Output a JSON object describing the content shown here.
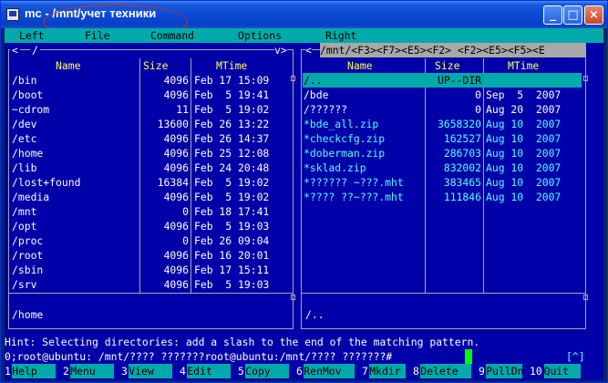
{
  "window": {
    "title": "mc - /mnt/учет техники",
    "controls": {
      "minimize": "_",
      "maximize": "□",
      "close": "×"
    }
  },
  "menu": [
    "Left",
    "File",
    "Command",
    "Options",
    "Right"
  ],
  "left_panel": {
    "path": "/",
    "corner_right": "v>",
    "corner_left": "<",
    "columns": [
      "Name",
      "Size",
      "MTime"
    ],
    "rows": [
      {
        "name": "/bin",
        "size": "4096",
        "date": "Feb 17 15:09"
      },
      {
        "name": "/boot",
        "size": "4096",
        "date": "Feb  5 19:41"
      },
      {
        "name": "~cdrom",
        "size": "11",
        "date": "Feb  5 19:02"
      },
      {
        "name": "/dev",
        "size": "13600",
        "date": "Feb 26 13:22"
      },
      {
        "name": "/etc",
        "size": "4096",
        "date": "Feb 26 14:37"
      },
      {
        "name": "/home",
        "size": "4096",
        "date": "Feb 25 12:08"
      },
      {
        "name": "/lib",
        "size": "4096",
        "date": "Feb 24 20:48"
      },
      {
        "name": "/lost+found",
        "size": "16384",
        "date": "Feb  5 19:02"
      },
      {
        "name": "/media",
        "size": "4096",
        "date": "Feb  5 19:02"
      },
      {
        "name": "/mnt",
        "size": "0",
        "date": "Feb 18 17:41"
      },
      {
        "name": "/opt",
        "size": "4096",
        "date": "Feb  5 19:03"
      },
      {
        "name": "/proc",
        "size": "0",
        "date": "Feb 26 09:04"
      },
      {
        "name": "/root",
        "size": "4096",
        "date": "Feb 16 20:01"
      },
      {
        "name": "/sbin",
        "size": "4096",
        "date": "Feb 17 15:11"
      },
      {
        "name": "/srv",
        "size": "4096",
        "date": "Feb  5 19:03"
      }
    ],
    "status": "/home"
  },
  "right_panel": {
    "path": "/mnt/<F3><F7><E5><F2> <F2><E5><F5><E",
    "corner_left": "<",
    "columns": [
      "Name",
      "Size",
      "MTime"
    ],
    "rows": [
      {
        "name": "/..",
        "size": "UP--DIR",
        "date": ""
      },
      {
        "name": "/bde",
        "size": "0",
        "date": "Sep  5  2007"
      },
      {
        "name": "/??????",
        "size": "0",
        "date": "Aug 20  2007"
      },
      {
        "name": "*bde_all.zip",
        "size": "3658320",
        "date": "Aug 10  2007"
      },
      {
        "name": "*checkcfg.zip",
        "size": "162527",
        "date": "Aug 10  2007"
      },
      {
        "name": "*doberman.zip",
        "size": "286703",
        "date": "Aug 10  2007"
      },
      {
        "name": "*sklad.zip",
        "size": "832002",
        "date": "Aug 10  2007"
      },
      {
        "name": "*?????? ~???.mht",
        "size": "383465",
        "date": "Aug 10  2007"
      },
      {
        "name": "*???? ??~???.mht",
        "size": "111846",
        "date": "Aug 10  2007"
      }
    ],
    "status": "/.."
  },
  "hint": "Hint: Selecting directories: add a slash to the end of the matching pattern.",
  "command_line": "0;root@ubuntu: /mnt/???? ???????root@ubuntu:/mnt/???? ???????#",
  "prompt_marker": "[^]",
  "function_keys": [
    {
      "num": "1",
      "label": "Help"
    },
    {
      "num": "2",
      "label": "Menu"
    },
    {
      "num": "3",
      "label": "View"
    },
    {
      "num": "4",
      "label": "Edit"
    },
    {
      "num": "5",
      "label": "Copy"
    },
    {
      "num": "6",
      "label": "RenMov"
    },
    {
      "num": "7",
      "label": "Mkdir"
    },
    {
      "num": "8",
      "label": "Delete"
    },
    {
      "num": "9",
      "label": "PullDn"
    },
    {
      "num": "10",
      "label": "Quit"
    }
  ]
}
